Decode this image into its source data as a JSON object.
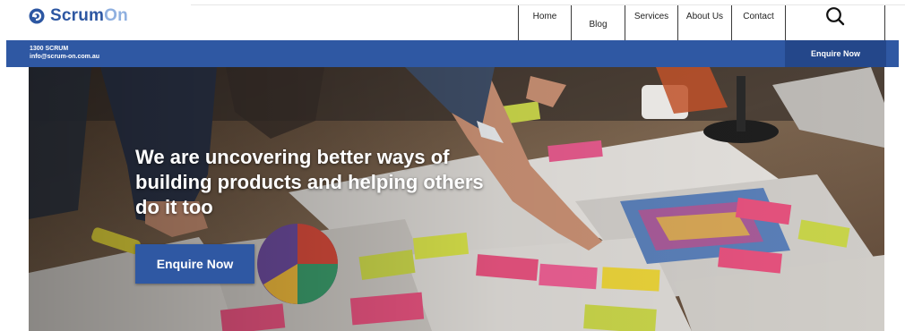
{
  "brand": {
    "name_part1": "Scrum",
    "name_part2": "On",
    "color_primary": "#2d57a2",
    "color_light": "#8fb0e0"
  },
  "nav": {
    "items": [
      {
        "label": "Home"
      },
      {
        "label": "Blog"
      },
      {
        "label": "Services"
      },
      {
        "label": "About Us"
      },
      {
        "label": "Contact"
      }
    ],
    "search_icon": "search-icon"
  },
  "contact_bar": {
    "phone": "1300 SCRUM",
    "email": "info@scrum-on.com.au",
    "cta_label": "Enquire Now",
    "color": "#2f58a3"
  },
  "hero": {
    "title": "We are uncovering better ways of building products and helping others do it too",
    "cta_label": "Enquire Now"
  }
}
